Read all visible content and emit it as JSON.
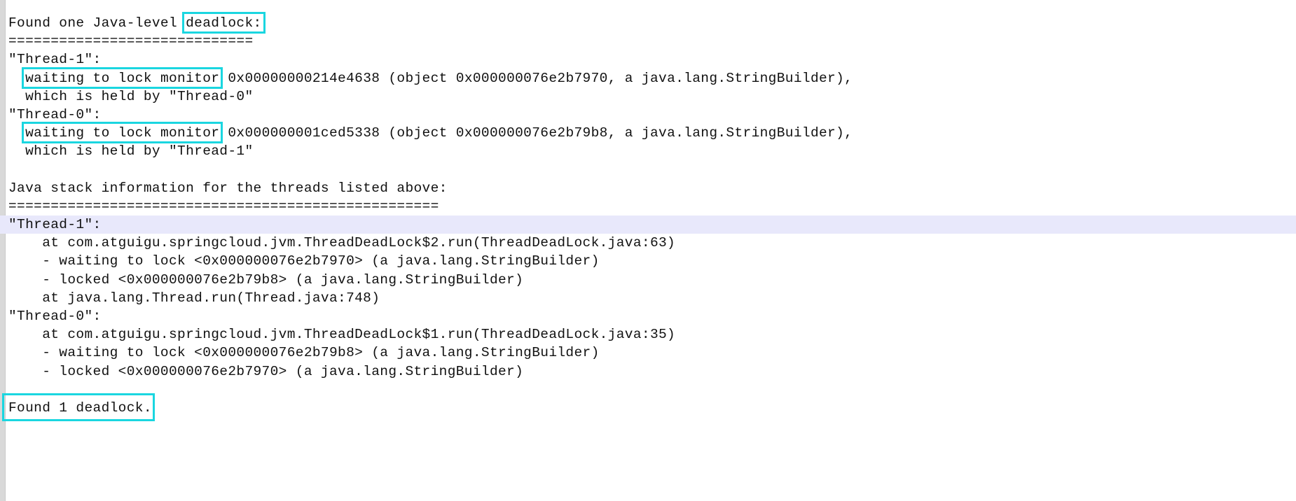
{
  "theme": {
    "background": "#ffffff",
    "text_color": "#111111",
    "gutter_color": "#d9d9d9",
    "highlight_row_color": "#e8e8fb",
    "annotation_box_color": "#1ad6e0"
  },
  "log": {
    "header": "Found one Java-level ",
    "header_boxed": "deadlock:",
    "separator_1": "=============================",
    "thread1_label": "\"Thread-1\":",
    "t1_wait_boxed": "waiting to lock monitor",
    "t1_wait_rest": " 0x00000000214e4638 (object 0x000000076e2b7970, a java.lang.StringBuilder),",
    "t1_held_by": "  which is held by \"Thread-0\"",
    "thread0_label": "\"Thread-0\":",
    "t0_wait_boxed": "waiting to lock monitor",
    "t0_wait_rest": " 0x000000001ced5338 (object 0x000000076e2b79b8, a java.lang.StringBuilder),",
    "t0_held_by": "  which is held by \"Thread-1\"",
    "stack_info_title": "Java stack information for the threads listed above:",
    "separator_2": "===================================================",
    "stack_thread1_label": "\"Thread-1\":",
    "stack_t1_line1": "    at com.atguigu.springcloud.jvm.ThreadDeadLock$2.run(ThreadDeadLock.java:63)",
    "stack_t1_line2": "    - waiting to lock <0x000000076e2b7970> (a java.lang.StringBuilder)",
    "stack_t1_line3": "    - locked <0x000000076e2b79b8> (a java.lang.StringBuilder)",
    "stack_t1_line4": "    at java.lang.Thread.run(Thread.java:748)",
    "stack_thread0_label": "\"Thread-0\":",
    "stack_t0_line1": "    at com.atguigu.springcloud.jvm.ThreadDeadLock$1.run(ThreadDeadLock.java:35)",
    "stack_t0_line2": "    - waiting to lock <0x000000076e2b79b8> (a java.lang.StringBuilder)",
    "stack_t0_line3": "    - locked <0x000000076e2b7970> (a java.lang.StringBuilder)",
    "footer_boxed": "Found 1 deadlock."
  },
  "annotations": {
    "boxes": [
      "deadlock:",
      "waiting to lock monitor",
      "waiting to lock monitor",
      "Found 1 deadlock."
    ],
    "highlighted_row": "\"Thread-1\":"
  }
}
